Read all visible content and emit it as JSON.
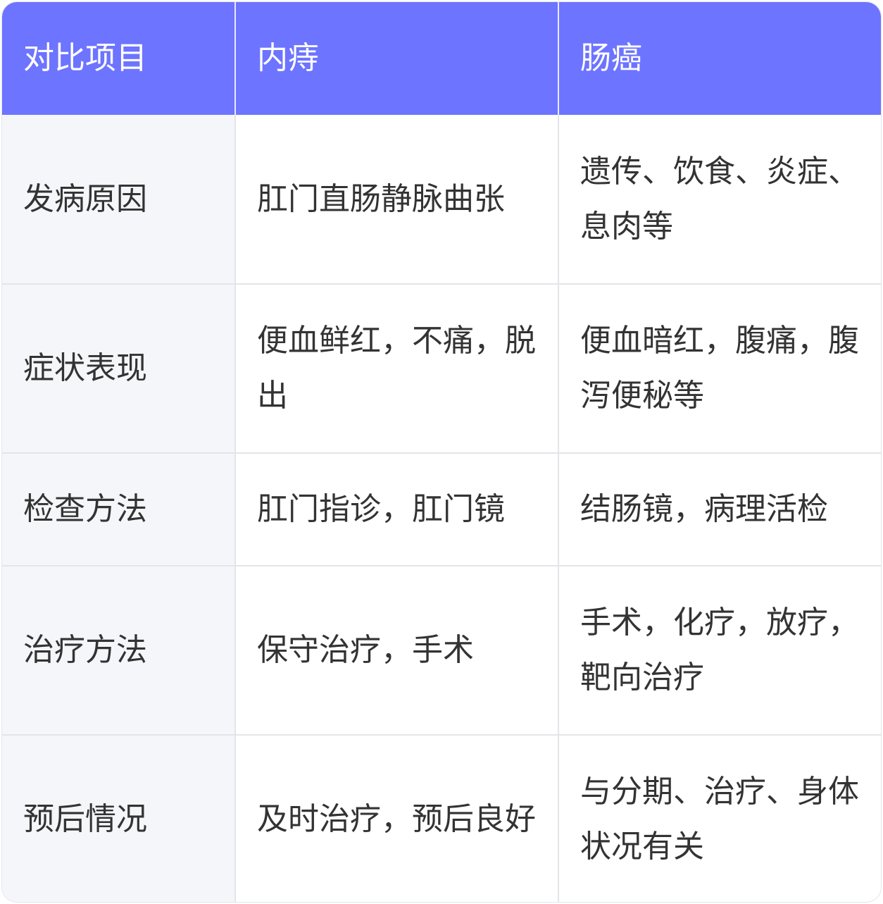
{
  "header": {
    "col1": "对比项目",
    "col2": "内痔",
    "col3": "肠癌"
  },
  "rows": [
    {
      "item": "发病原因",
      "hemorrhoid": "肛门直肠静脉曲张",
      "cancer": "遗传、饮食、炎症、息肉等"
    },
    {
      "item": "症状表现",
      "hemorrhoid": "便血鲜红，不痛，脱出",
      "cancer": "便血暗红，腹痛，腹泻便秘等"
    },
    {
      "item": "检查方法",
      "hemorrhoid": "肛门指诊，肛门镜",
      "cancer": "结肠镜，病理活检"
    },
    {
      "item": "治疗方法",
      "hemorrhoid": "保守治疗，手术",
      "cancer": "手术，化疗，放疗，靶向治疗"
    },
    {
      "item": "预后情况",
      "hemorrhoid": "及时治疗，预后良好",
      "cancer": "与分期、治疗、身体状况有关"
    }
  ],
  "colors": {
    "header_bg": "#6d74ff",
    "header_text": "#ffffff",
    "label_bg": "#f5f6fa",
    "border": "#e3e5ea",
    "text": "#333333"
  }
}
